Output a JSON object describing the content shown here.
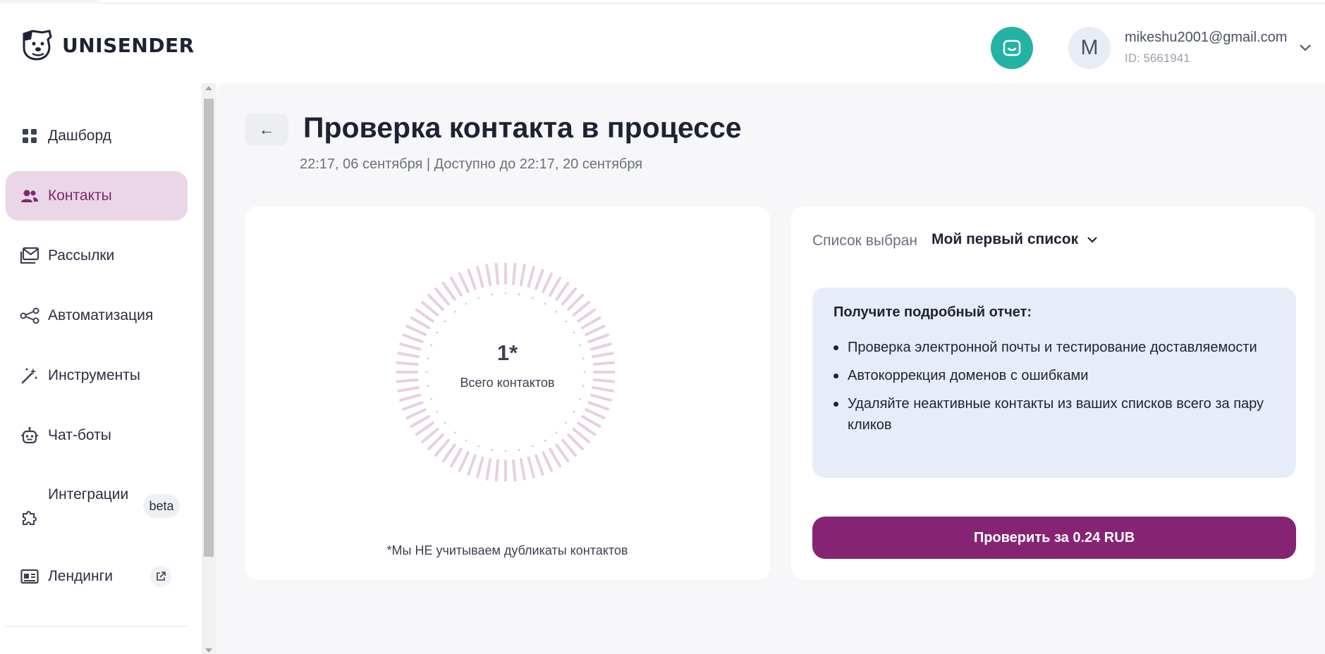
{
  "app": {
    "brand": "UNISENDER"
  },
  "user": {
    "avatar_letter": "M",
    "email": "mikeshu2001@gmail.com",
    "id_text": "ID: 5661941"
  },
  "sidebar": {
    "items": [
      {
        "label": "Дашборд",
        "icon": "grid-icon"
      },
      {
        "label": "Контакты",
        "icon": "users-icon",
        "active": true
      },
      {
        "label": "Рассылки",
        "icon": "mail-stack-icon"
      },
      {
        "label": "Автоматизация",
        "icon": "workflow-icon"
      },
      {
        "label": "Инструменты",
        "icon": "magic-wand-icon"
      },
      {
        "label": "Чат-боты",
        "icon": "robot-icon"
      },
      {
        "label": "Интеграции",
        "icon": "puzzle-icon",
        "badge": "beta"
      },
      {
        "label": "Лендинги",
        "icon": "landing-icon",
        "external": true
      }
    ]
  },
  "page": {
    "back_label": "←",
    "title": "Проверка контакта в процессе",
    "subtitle": "22:17, 06 сентября | Доступно до 22:17, 20 сентября"
  },
  "stats": {
    "count": "1*",
    "count_label": "Всего контактов",
    "note": "*Мы НЕ учитываем дубликаты контактов"
  },
  "list": {
    "label": "Список выбран",
    "selected": "Мой первый список"
  },
  "report": {
    "title": "Получите подробный отчет:",
    "items": [
      "Проверка электронной почты и тестирование доставляемости",
      "Автокоррекция доменов с ошибками",
      "Удаляйте неактивные контакты из ваших списков всего за пару кликов"
    ]
  },
  "cta": {
    "label": "Проверить за 0.24 RUB"
  },
  "colors": {
    "accent": "#862473",
    "active_bg": "#ead6e6",
    "chat": "#22b3a5",
    "info_bg": "#e6ecf8",
    "ring": "#e8cfe1"
  }
}
